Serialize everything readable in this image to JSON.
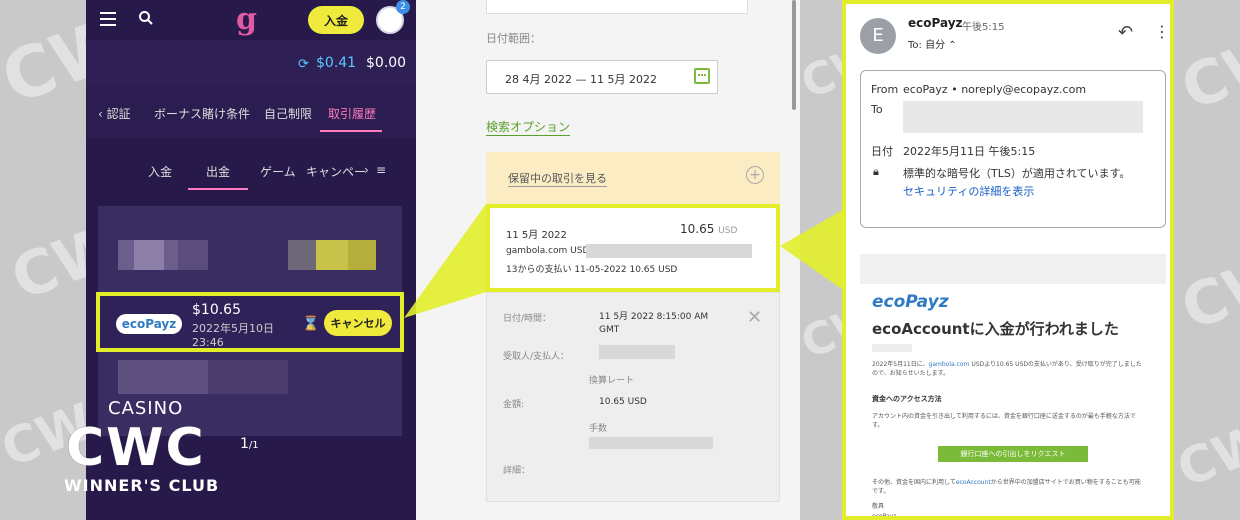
{
  "colors": {
    "highlight": "#e3ee2b",
    "app_bg": "#271a4a",
    "accent_pink": "#ff7ac0",
    "button_yellow": "#f0ea3c",
    "eco_blue": "#2f7bc4",
    "eco_green": "#7cbb3a"
  },
  "watermark": {
    "brand": "CWC",
    "casino": "CASINO",
    "winners": "WINNER'S CLUB"
  },
  "app": {
    "deposit_label": "入金",
    "avatar_badge": "2",
    "balance": {
      "bonus": "$0.41",
      "cash": "$0.00"
    },
    "main_tabs": [
      {
        "label": "‹  認証"
      },
      {
        "label": "ボーナス賭け条件"
      },
      {
        "label": "自己制限"
      },
      {
        "label": "取引履歴",
        "active": true
      }
    ],
    "sub_tabs": [
      {
        "label": "入金"
      },
      {
        "label": "出金",
        "active": true
      },
      {
        "label": "ゲーム"
      },
      {
        "label": "キャンペー"
      }
    ],
    "transaction": {
      "method_logo": "ecoPayz",
      "amount": "$10.65",
      "date": "2022年5月10日 23:46",
      "cancel_label": "キャンセル"
    },
    "pager": {
      "current": "1",
      "total": "/1"
    }
  },
  "eco_web": {
    "date_range_label": "日付範囲：",
    "date_range_value": "28 4月 2022 — 11 5月 2022",
    "search_options": "検索オプション",
    "pending_link": "保留中の取引を見る",
    "tx_card": {
      "date": "11 5月 2022",
      "amount": "10.65",
      "currency": "USD",
      "line1": "gambola.com USD",
      "line2": "13からの支払い 11-05-2022 10.65 USD"
    },
    "details": {
      "datetime_label": "日付/時間：",
      "datetime_value": "11 5月 2022 8:15:00 AM GMT",
      "payee_label": "受取人/支払人：",
      "rate_label": "換算レート",
      "amount_label": "金額:",
      "amount_value": "10.65 USD",
      "fee_label": "手数",
      "detail_label": "詳細："
    }
  },
  "email": {
    "avatar_letter": "E",
    "sender": "ecoPayz",
    "time": "午後5:15",
    "to_line": "To: 自分 ⌃",
    "from_label": "From",
    "from_value": "ecoPayz • noreply@ecopayz.com",
    "to_label": "To",
    "date_label": "日付",
    "date_value": "2022年5月11日 午後5:15",
    "security_value": "標準的な暗号化（TLS）が適用されています。",
    "security_link": "セキュリティの詳細を表示",
    "body_logo": "ecoPayz",
    "body_title": "ecoAccountに入金が行われました",
    "body_p1_a": "2022年5月11日に、",
    "body_p1_link": "gambola.com",
    "body_p1_b": " USDより10.65 USDの支払いがあり、受け取りが完了しましたので、お知らせいたします。",
    "body_h": "資金へのアクセス方法",
    "body_p2": "アカウント内の資金を引き出して利用するには、資金を銀行口座に送金するのが最も手軽な方法です。",
    "body_button": "銀行口座への引出しをリクエスト",
    "body_p3_a": "その他、資金を国内に利用して",
    "body_p3_link": "ecoAccount",
    "body_p3_b": "から世界中の加盟店サイトでお買い物をすることも可能です。",
    "body_sign": "敬具",
    "body_sign2": "ecoPayz"
  }
}
